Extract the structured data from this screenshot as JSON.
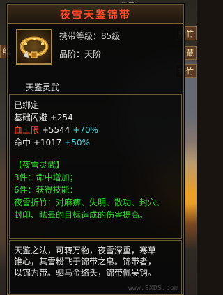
{
  "scene": {
    "edge_labels": [
      "练",
      "折竹",
      "藏",
      "折竹"
    ],
    "top_text": "备用"
  },
  "tooltip": {
    "title": "夜雪天鉴锦带",
    "carry_level": "携带等级：85级",
    "grade": "品阶：天阶",
    "section_name": "天鉴灵武",
    "bound": "已绑定",
    "stats": [
      {
        "label": "基础闪避",
        "value": "+254",
        "bonus": ""
      },
      {
        "label": "血上限",
        "value": "+5544",
        "bonus": "+70%"
      },
      {
        "label": "命中",
        "value": "+1017",
        "bonus": "+50%"
      }
    ],
    "set_name": "【夜雪灵武】",
    "set_bonus_3": "3件：命中增加；",
    "set_bonus_6": "6件：获得技能：",
    "skill_desc_1": "夜雪折竹：对麻痹、失明、散功、封穴、",
    "skill_desc_2": "封印、眩晕的目标造成的伤害提高。",
    "flavor_1": "天鉴之法，可转万物，夜雪深重，寒草",
    "flavor_2": "锥心，其雪粉飞于锦带之帛。锦带者，",
    "flavor_3": "以锦为带。驷马金络头，锦带佩吴钩。",
    "watermark": "www.SXDS.com"
  },
  "colors": {
    "title": "#ff4a2a",
    "set_green": "#33dd33",
    "bonus_cyan": "#4ad8e8"
  },
  "icons": {
    "item": "belt-icon"
  }
}
